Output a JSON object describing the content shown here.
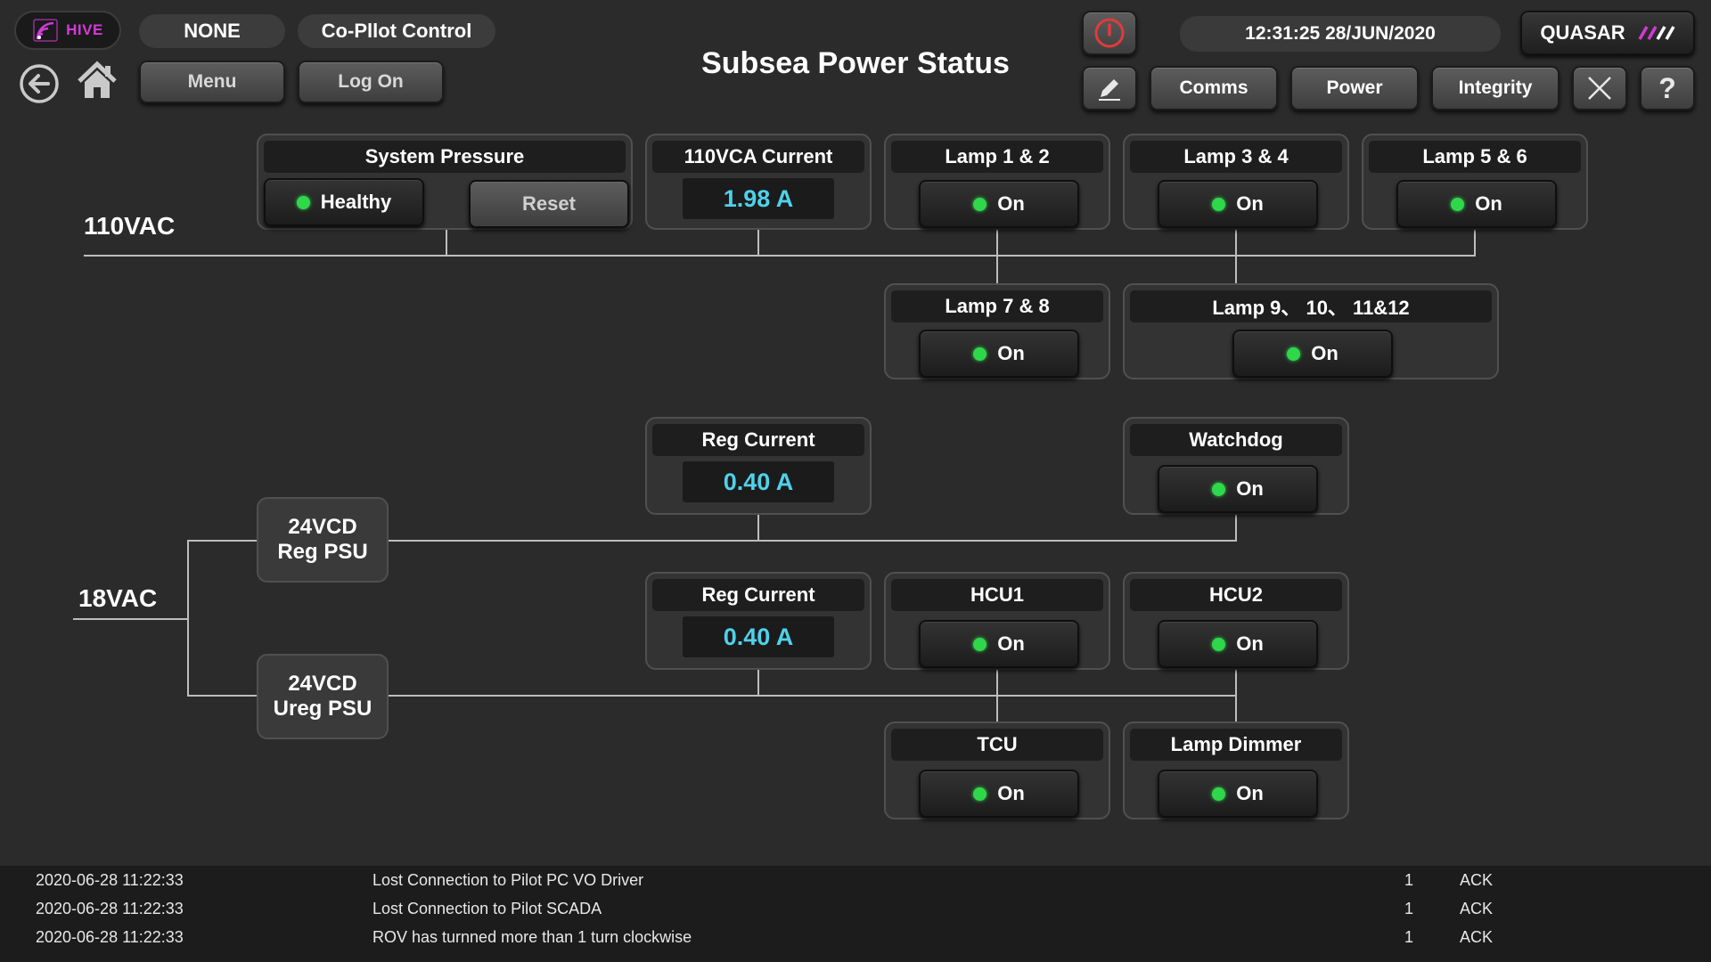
{
  "header": {
    "logo_text": "HIVE",
    "mode": "NONE",
    "control": "Co-Pllot Control",
    "menu_label": "Menu",
    "logon_label": "Log On",
    "title": "Subsea Power Status",
    "datetime": "12:31:25  28/JUN/2020",
    "vehicle": "QUASAR",
    "nav_tabs": [
      "Comms",
      "Power",
      "Integrity"
    ],
    "help_label": "?"
  },
  "bus_110": {
    "label": "110VAC",
    "system_pressure": {
      "title": "System Pressure",
      "status": "Healthy",
      "reset_label": "Reset"
    },
    "current": {
      "title": "110VCA Current",
      "value": "1.98 A"
    },
    "lamps": [
      {
        "title": "Lamp 1 & 2",
        "state": "On"
      },
      {
        "title": "Lamp 3 & 4",
        "state": "On"
      },
      {
        "title": "Lamp 5 & 6",
        "state": "On"
      },
      {
        "title": "Lamp 7 & 8",
        "state": "On"
      },
      {
        "title": "Lamp 9、 10、 11&12",
        "state": "On"
      }
    ]
  },
  "bus_18": {
    "label": "18VAC",
    "reg_psu": {
      "line1": "24VCD",
      "line2": "Reg PSU"
    },
    "ureg_psu": {
      "line1": "24VCD",
      "line2": "Ureg PSU"
    },
    "reg_current_1": {
      "title": "Reg Current",
      "value": "0.40 A"
    },
    "reg_current_2": {
      "title": "Reg Current",
      "value": "0.40 A"
    },
    "watchdog": {
      "title": "Watchdog",
      "state": "On"
    },
    "hcu1": {
      "title": "HCU1",
      "state": "On"
    },
    "hcu2": {
      "title": "HCU2",
      "state": "On"
    },
    "tcu": {
      "title": "TCU",
      "state": "On"
    },
    "lamp_dimmer": {
      "title": "Lamp Dimmer",
      "state": "On"
    }
  },
  "alarms": [
    {
      "time": "2020-06-28  11:22:33",
      "message": "Lost Connection to Pilot PC VO Driver",
      "count": "1",
      "ack": "ACK"
    },
    {
      "time": "2020-06-28  11:22:33",
      "message": "Lost Connection to Pilot SCADA",
      "count": "1",
      "ack": "ACK"
    },
    {
      "time": "2020-06-28  11:22:33",
      "message": "ROV has turnned more than 1 turn clockwise",
      "count": "1",
      "ack": "ACK"
    }
  ],
  "colors": {
    "background": "#2b2b2b",
    "status_on": "#2fd84b",
    "value_text": "#4fd1ea",
    "logo_accent": "#d23ad6",
    "power_icon": "#e23a3a"
  },
  "icons": [
    "wifi-logo-icon",
    "back-arrow-icon",
    "home-icon",
    "power-icon",
    "pencil-icon",
    "close-x-icon",
    "help-icon"
  ]
}
